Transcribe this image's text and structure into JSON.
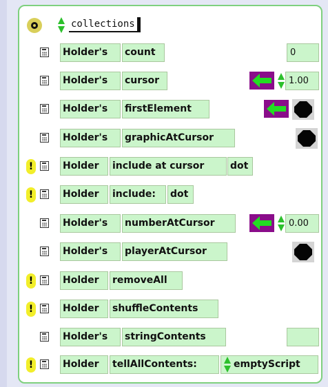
{
  "category": {
    "label": "collections"
  },
  "rows": [
    {
      "object": "Holder's",
      "slot": "count",
      "value": "0"
    },
    {
      "object": "Holder's",
      "slot": "cursor",
      "value": "1.00"
    },
    {
      "object": "Holder's",
      "slot": "firstElement"
    },
    {
      "object": "Holder's",
      "slot": "graphicAtCursor"
    },
    {
      "object": "Holder",
      "command": "include at cursor",
      "arg": "dot"
    },
    {
      "object": "Holder",
      "command": "include:",
      "arg": "dot"
    },
    {
      "object": "Holder's",
      "slot": "numberAtCursor",
      "value": "0.00"
    },
    {
      "object": "Holder's",
      "slot": "playerAtCursor"
    },
    {
      "object": "Holder",
      "command": "removeAll"
    },
    {
      "object": "Holder",
      "command": "shuffleContents"
    },
    {
      "object": "Holder's",
      "slot": "stringContents",
      "value": ""
    },
    {
      "object": "Holder",
      "command": "tellAllContents:",
      "arg": "emptyScript"
    }
  ],
  "colors": {
    "tile_bg": "#cbf5cb",
    "arrow_bg": "#8a0d8a",
    "arrow_fg": "#22dd22",
    "bang_bg": "#f2ee2a",
    "frame": "#7ed07e"
  },
  "icons": {
    "menu": "circle-menu-icon",
    "stepper": "up-down-arrows-icon",
    "script": "script-sheet-icon",
    "alert": "exclamation-icon",
    "assign": "left-arrow-icon",
    "player": "black-ball-icon"
  }
}
